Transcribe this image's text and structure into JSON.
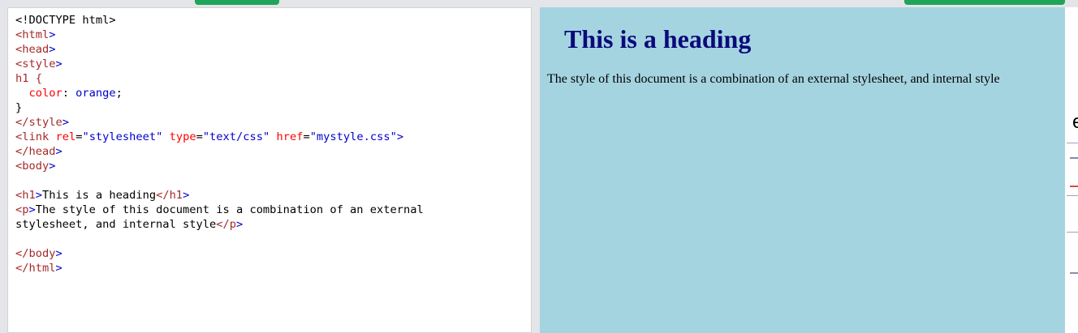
{
  "editor": {
    "lines": [
      "<!DOCTYPE html>",
      "<html>",
      "<head>",
      "<style>",
      "h1 {",
      "  color: orange;",
      "}",
      "</style>",
      "<link rel=\"stylesheet\" type=\"text/css\" href=\"mystyle.css\">",
      "</head>",
      "<body>",
      "",
      "<h1>This is a heading</h1>",
      "<p>The style of this document is a combination of an external",
      "stylesheet, and internal style</p>",
      "",
      "</body>",
      "</html>"
    ]
  },
  "preview": {
    "heading": "This is a heading",
    "paragraph": "The style of this document is a combination of an external stylesheet, and internal style"
  },
  "colors": {
    "tab_green": "#20a45a",
    "preview_background": "#a5d4e1",
    "heading_color": "#0b0a7a",
    "code_tag": "#a52a2a",
    "code_bracket": "#0000cd",
    "code_attr": "#ff0000"
  },
  "icons": {
    "edge_partial_glyph": "e"
  }
}
